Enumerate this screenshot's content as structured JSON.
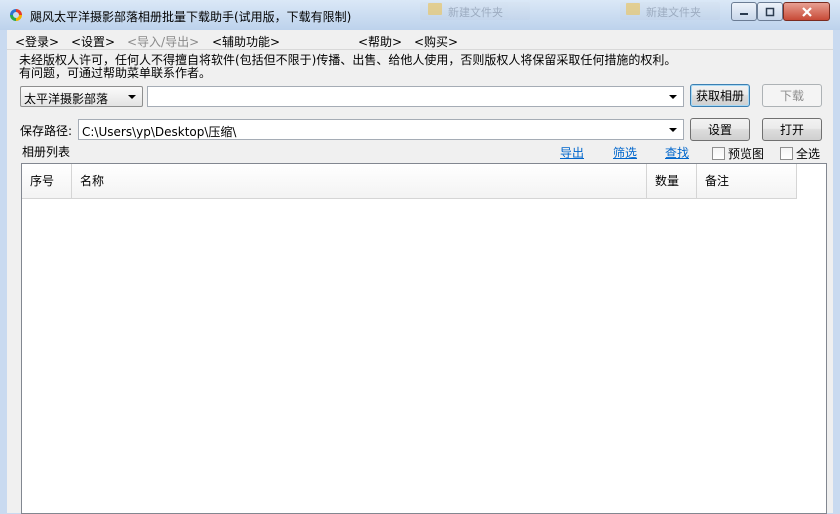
{
  "window": {
    "title": "飓风太平洋摄影部落相册批量下载助手(试用版，下载有限制)",
    "background_tab_1": "新建文件夹",
    "background_tab_2": "新建文件夹"
  },
  "menu": [
    {
      "label": "<登录>",
      "enabled": true
    },
    {
      "label": "<设置>",
      "enabled": true
    },
    {
      "label": "<导入/导出>",
      "enabled": false
    },
    {
      "label": "<辅助功能>",
      "enabled": true
    },
    {
      "label": "<帮助>",
      "enabled": true
    },
    {
      "label": "<购买>",
      "enabled": true
    }
  ],
  "notice": {
    "line1": "未经版权人许可，任何人不得擅自将软件(包括但不限于)传播、出售、给他人使用，否则版权人将保留采取任何措施的权利。",
    "line2": "有问题，可通过帮助菜单联系作者。"
  },
  "source": {
    "selected": "太平洋摄影部落",
    "url_value": ""
  },
  "buttons": {
    "get_album": "获取相册",
    "download": "下载",
    "settings": "设置",
    "open": "打开"
  },
  "save_path": {
    "label": "保存路径:",
    "value": "C:\\Users\\yp\\Desktop\\压缩\\"
  },
  "album_list": {
    "label": "相册列表",
    "links": {
      "export": "导出",
      "filter": "筛选",
      "find": "查找"
    },
    "preview_label": "预览图",
    "select_all_label": "全选",
    "preview_checked": false,
    "select_all_checked": false,
    "columns": [
      "序号",
      "名称",
      "数量",
      "备注"
    ],
    "rows": []
  }
}
